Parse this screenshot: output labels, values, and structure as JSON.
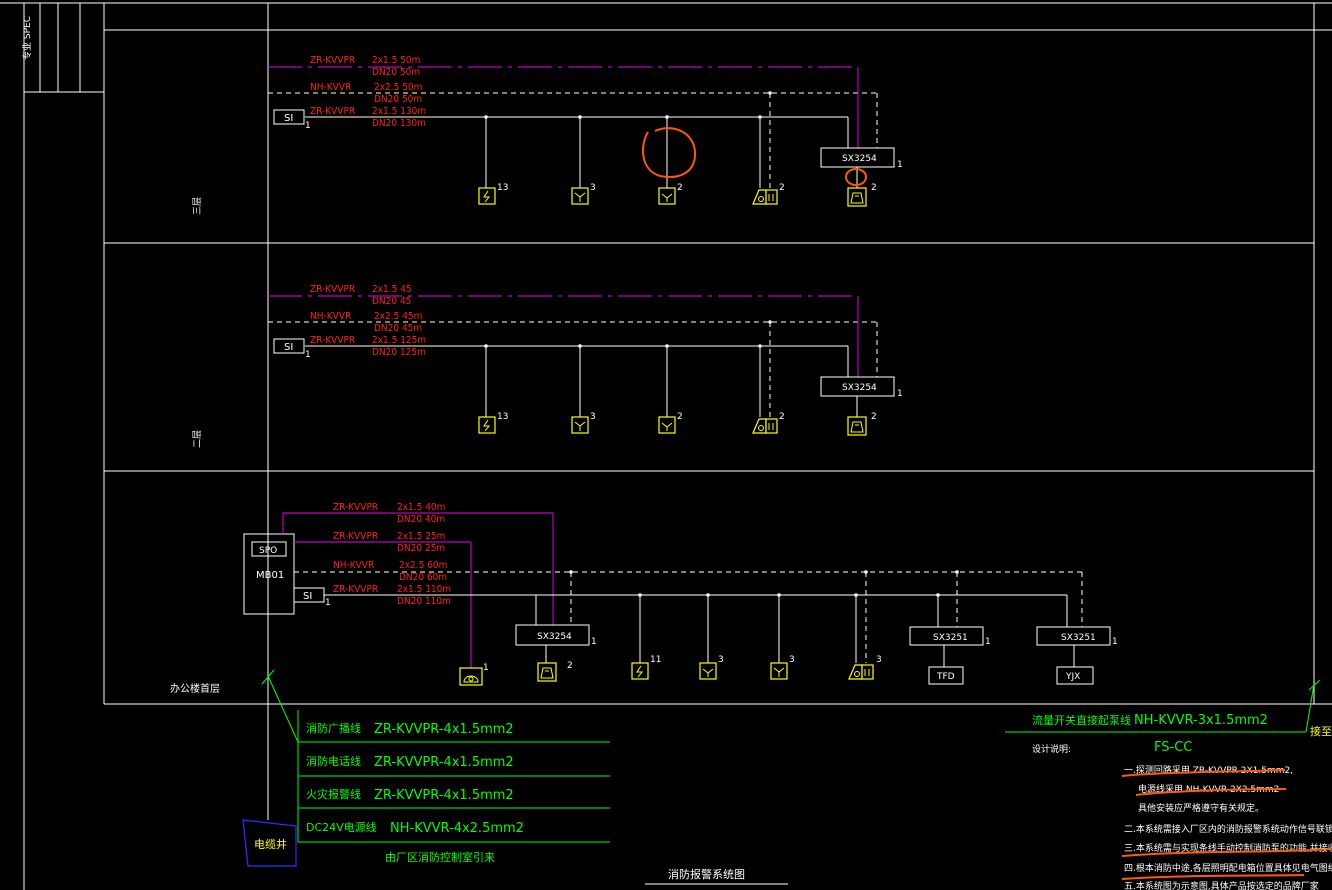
{
  "floors": {
    "third": {
      "label": "三层"
    },
    "second": {
      "label": "二层"
    },
    "first": {
      "label": "办公楼首层"
    },
    "title_block": "专业 SPEC"
  },
  "third_floor": {
    "cable1": {
      "type": "ZR-KVVPR",
      "spec": "2x1.5 50m",
      "conduit": "DN20 50m"
    },
    "cable2": {
      "type": "NH-KVVR",
      "spec": "2x2.5 50m",
      "conduit": "DN20 50m"
    },
    "cable3": {
      "type": "ZR-KVVPR",
      "spec": "2x1.5 130m",
      "conduit": "DN20 130m"
    },
    "si": "SI",
    "module": "SX3254",
    "counts": [
      "13",
      "3",
      "2",
      "2",
      "2"
    ],
    "module_num": "1",
    "si_num": "1"
  },
  "second_floor": {
    "cable1": {
      "type": "ZR-KVVPR",
      "spec": "2x1.5 45",
      "conduit": "DN20 45"
    },
    "cable2": {
      "type": "NH-KVVR",
      "spec": "2x2.5 45m",
      "conduit": "DN20 45m"
    },
    "cable3": {
      "type": "ZR-KVVPR",
      "spec": "2x1.5 125m",
      "conduit": "DN20 125m"
    },
    "si": "SI",
    "module": "SX3254",
    "counts": [
      "13",
      "3",
      "2",
      "2",
      "2"
    ],
    "module_num": "1",
    "si_num": "1"
  },
  "first_floor": {
    "panel": {
      "spo": "SPO",
      "name": "MB01"
    },
    "cable1": {
      "type": "ZR-KVVPR",
      "spec": "2x1.5 40m",
      "conduit": "DN20 40m"
    },
    "cable2": {
      "type": "ZR-KVVPR",
      "spec": "2x1.5 25m",
      "conduit": "DN20 25m"
    },
    "cable3": {
      "type": "NH-KVVR",
      "spec": "2x2.5 60m",
      "conduit": "DN20 60m"
    },
    "cable4": {
      "type": "ZR-KVVPR",
      "spec": "2x1.5 110m",
      "conduit": "DN20 110m"
    },
    "si": "SI",
    "modules": [
      "SX3254",
      "SX3251",
      "SX3251"
    ],
    "tfd": "TFD",
    "yjx": "YJX",
    "counts": [
      "1",
      "2",
      "11",
      "3",
      "3",
      "3"
    ],
    "module_nums": [
      "1",
      "1",
      "1"
    ],
    "si_num": "1"
  },
  "legend": [
    {
      "name": "消防广播线",
      "cable": "ZR-KVVPR-4x1.5mm2"
    },
    {
      "name": "消防电话线",
      "cable": "ZR-KVVPR-4x1.5mm2"
    },
    {
      "name": "火灾报警线",
      "cable": "ZR-KVVPR-4x1.5mm2"
    },
    {
      "name": "DC24V电源线",
      "cable": "NH-KVVR-4x2.5mm2"
    }
  ],
  "legend_source": "由厂区消防控制室引来",
  "cable_well": "电缆井",
  "flow_switch": {
    "name": "流量开关直接起泵线",
    "cable": "NH-KVVR-3x1.5mm2",
    "to": "接至消"
  },
  "design_notes": {
    "heading": "设计说明:",
    "code": "FS-CC",
    "lines": [
      "一.探测回路采用 ZR-KVVPR 2X1.5mm2,",
      "电源线采用 NH-KVVR 2X2.5mm2",
      "具他安装应严格遵守有关规定。",
      "二.本系统需接入厂区内的消防报警系统动作信号联锁启动消防泵。",
      "三.本系统需与实现条线手动控制消防泵的功能,并接收泵的启动信号",
      "四.根本消防中途,各层照明配电箱位置具体见电气图纸。",
      "五.本系统图为示意图,具体产品按选定的品牌厂家"
    ]
  },
  "diagram_title": "消防报警系统图",
  "colors": {
    "cable_label": "#ff2020",
    "device": "#ffff00",
    "legend": "#00ff00",
    "markup": "#ff5a00",
    "signal": "#c000c0"
  }
}
